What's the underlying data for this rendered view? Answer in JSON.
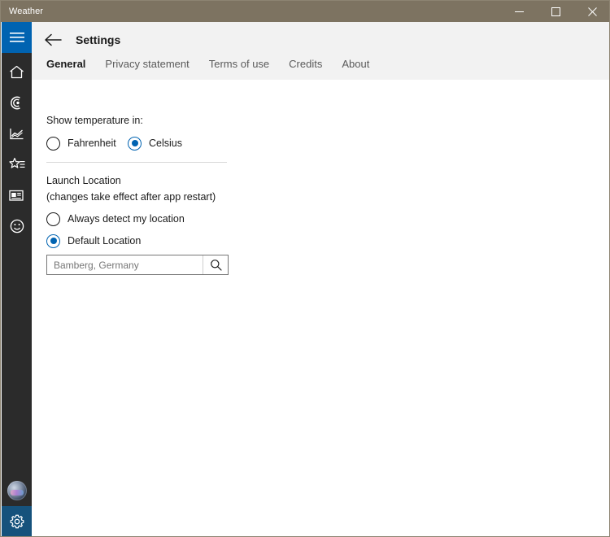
{
  "window": {
    "title": "Weather",
    "caption_buttons": [
      {
        "name": "minimize",
        "glyph": "minimize-icon"
      },
      {
        "name": "maximize",
        "glyph": "maximize-icon"
      },
      {
        "name": "close",
        "glyph": "close-icon"
      }
    ],
    "colors": {
      "titlebar": "#7d7361",
      "rail": "#2b2b2b",
      "accent": "#0063b1",
      "accent_dark": "#16527c",
      "header_band": "#f2f2f2"
    }
  },
  "rail": {
    "items": [
      {
        "icon": "hamburger-icon",
        "label": "Navigation",
        "active": true
      },
      {
        "icon": "home-icon",
        "label": "Forecast"
      },
      {
        "icon": "radar-icon",
        "label": "Maps"
      },
      {
        "icon": "chart-icon",
        "label": "Historical Weather"
      },
      {
        "icon": "favorites-star-icon",
        "label": "Places"
      },
      {
        "icon": "news-icon",
        "label": "News"
      },
      {
        "icon": "smiley-icon",
        "label": "Send Feedback"
      }
    ],
    "bottom": [
      {
        "icon": "avatar-icon",
        "label": "Account"
      },
      {
        "icon": "gear-icon",
        "label": "Settings",
        "active": true
      }
    ]
  },
  "header": {
    "back_label": "Back",
    "back_icon": "back-arrow-icon",
    "title": "Settings"
  },
  "tabs": [
    {
      "label": "General",
      "active": true
    },
    {
      "label": "Privacy statement",
      "active": false
    },
    {
      "label": "Terms of use",
      "active": false
    },
    {
      "label": "Credits",
      "active": false
    },
    {
      "label": "About",
      "active": false
    }
  ],
  "settings": {
    "temperature": {
      "heading": "Show temperature in:",
      "options": [
        {
          "label": "Fahrenheit",
          "selected": false
        },
        {
          "label": "Celsius",
          "selected": true
        }
      ]
    },
    "launch_location": {
      "heading": "Launch Location",
      "note": "(changes take effect after app restart)",
      "options": [
        {
          "label": "Always detect my location",
          "selected": false
        },
        {
          "label": "Default Location",
          "selected": true
        }
      ],
      "search": {
        "value": "Bamberg, Germany",
        "placeholder": "Search",
        "icon": "search-icon"
      }
    }
  }
}
